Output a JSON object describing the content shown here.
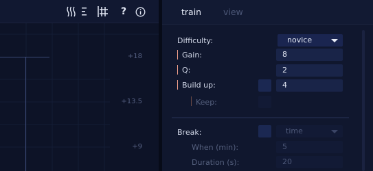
{
  "toolbar": {
    "icons": [
      "heat-waves-icon",
      "menu-lines-icon",
      "hash-icon",
      "help-icon",
      "info-icon"
    ],
    "help_glyph": "?"
  },
  "chart": {
    "y_ticks": [
      "+18",
      "+13.5",
      "+9"
    ]
  },
  "tabs": {
    "train": "train",
    "view": "view"
  },
  "settings": {
    "difficulty": {
      "label": "Difficulty:",
      "value": "novice"
    },
    "gain": {
      "label": "Gain:",
      "value": "8"
    },
    "q": {
      "label": "Q:",
      "value": "2"
    },
    "build_up": {
      "label": "Build up:",
      "value": "4"
    },
    "keep": {
      "label": "Keep:"
    },
    "break": {
      "label": "Break:",
      "value": "time"
    },
    "when": {
      "label": "When (min):",
      "value": "5"
    },
    "duration": {
      "label": "Duration (s):",
      "value": "20"
    }
  },
  "colors": {
    "accent_mark": "#f2a08c",
    "field_bg": "#192448",
    "panel_bg": "#10172e"
  }
}
